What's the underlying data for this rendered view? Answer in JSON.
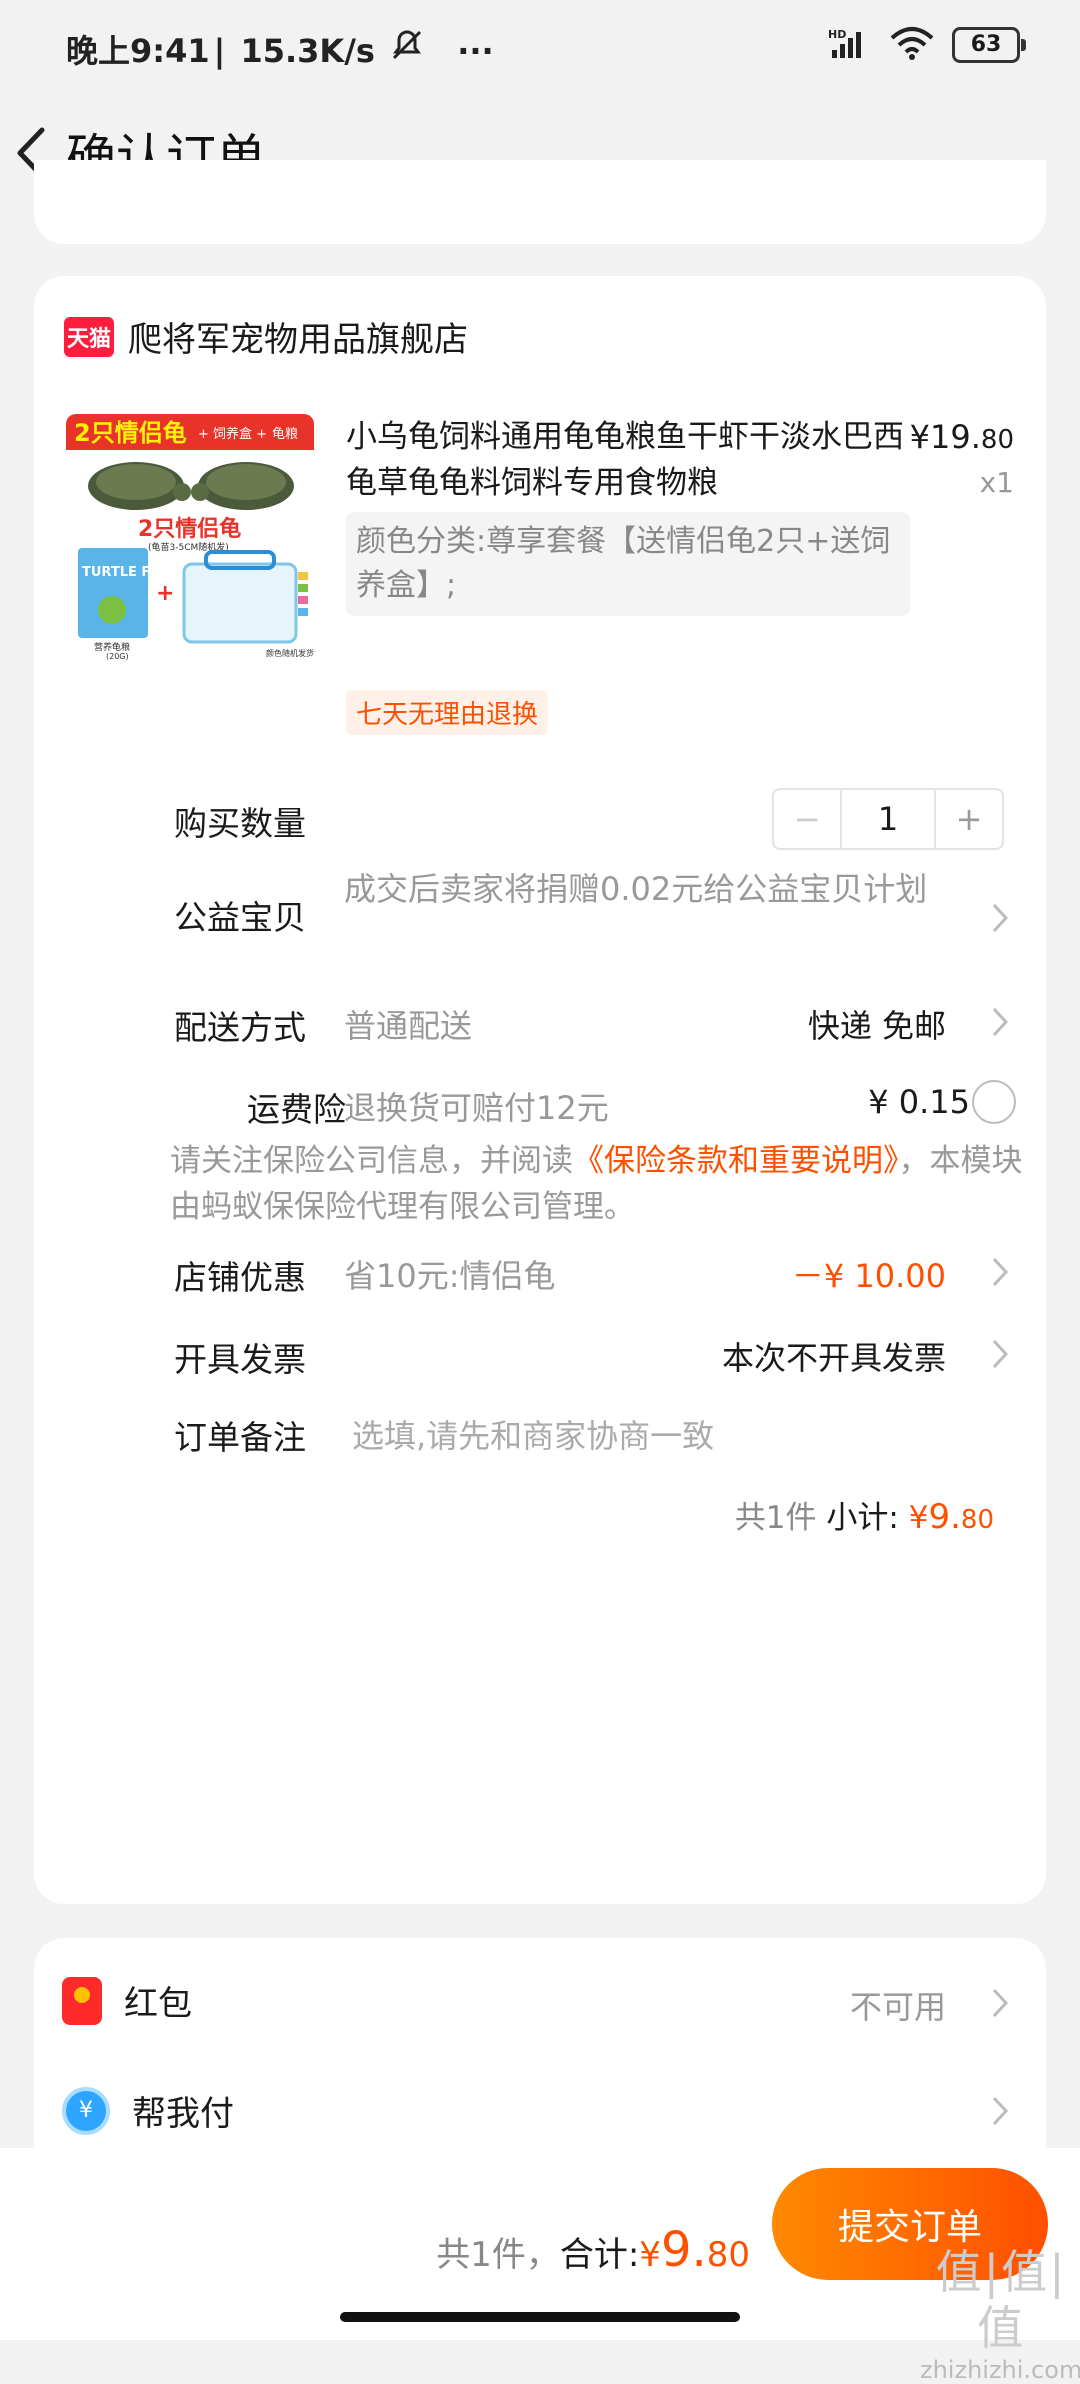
{
  "status_bar": {
    "time": "晚上9:41",
    "net_speed": "15.3K/s",
    "more": "···",
    "signal_label": "HD",
    "battery": "63"
  },
  "header": {
    "title": "确认订单"
  },
  "shop": {
    "badge": "天猫",
    "name": "爬将军宠物用品旗舰店"
  },
  "product": {
    "title": "小乌龟饲料通用龟龟粮鱼干虾干淡水巴西龟草龟龟料饲料专用食物粮",
    "price_main": "¥19.",
    "price_cents": "80",
    "quantity_x": "x1",
    "sku": "颜色分类:尊享套餐【送情侣龟2只+送饲养盒】;",
    "return_tag": "七天无理由退换",
    "image": {
      "banner": "2只情侣龟",
      "banner_extra1": "+ 饲养盒 +",
      "banner_extra2": "龟粮",
      "center_text": "2只情侣龟",
      "center_sub": "(龟苗3-5CM随机发)",
      "food_brand": "TURTLE FOOD",
      "food_label": "营养龟粮",
      "food_weight": "(20G)",
      "box_note": "颜色随机发货"
    }
  },
  "rows": {
    "quantity": {
      "label": "购买数量",
      "minus": "−",
      "value": "1",
      "plus": "+"
    },
    "charity": {
      "label": "公益宝贝",
      "desc": "成交后卖家将捐赠0.02元给公益宝贝计划"
    },
    "delivery": {
      "label": "配送方式",
      "desc": "普通配送",
      "value": "快递 免邮"
    },
    "freight_insurance": {
      "label": "运费险",
      "desc": "退换货可赔付12元",
      "value": "¥ 0.15"
    },
    "insurance_note": {
      "prefix": "请关注保险公司信息，并阅读",
      "link": "《保险条款和重要说明》",
      "suffix": "，本模块由蚂蚁保保险代理有限公司管理。"
    },
    "shop_discount": {
      "label": "店铺优惠",
      "desc": "省10元:情侣龟",
      "value": "－¥ 10.00"
    },
    "invoice": {
      "label": "开具发票",
      "value": "本次不开具发票"
    },
    "remark": {
      "label": "订单备注",
      "placeholder": "选填,请先和商家协商一致"
    }
  },
  "subtotal": {
    "count": "共1件",
    "label": "小计:",
    "currency": "¥",
    "amount_main": "9.",
    "amount_cents": "80"
  },
  "bottom_card": {
    "red_packet": {
      "label": "红包",
      "value": "不可用"
    },
    "pay_for_me": {
      "label": "帮我付",
      "icon_char": "¥"
    }
  },
  "footer": {
    "count": "共1件，",
    "total_label": "合计:",
    "currency": "¥",
    "total_main": "9.",
    "total_cents": "80",
    "submit": "提交订单"
  },
  "watermark": {
    "main": "值|值|值",
    "sub": "zhizhizhi.com"
  },
  "colors": {
    "accent": "#ff5000",
    "tmall": "#ff1d3d",
    "bg": "#f2f2f2"
  }
}
